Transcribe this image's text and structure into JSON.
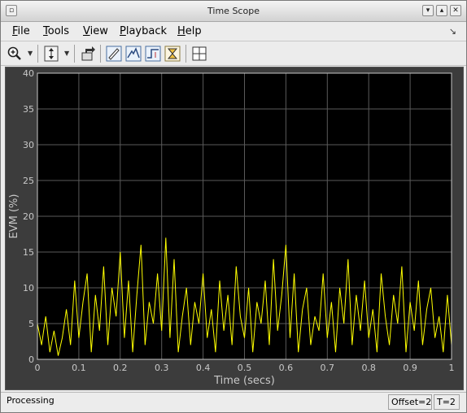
{
  "window": {
    "title": "Time Scope"
  },
  "menu": [
    {
      "label": "File",
      "ul": "F",
      "rest": "ile"
    },
    {
      "label": "Tools",
      "ul": "T",
      "rest": "ools"
    },
    {
      "label": "View",
      "ul": "V",
      "rest": "iew"
    },
    {
      "label": "Playback",
      "ul": "P",
      "rest": "layback"
    },
    {
      "label": "Help",
      "ul": "H",
      "rest": "elp"
    }
  ],
  "toolbar": {
    "icons": [
      "zoom-in-icon",
      "scale-axes-icon",
      "restore-view-icon",
      "measurement-icon",
      "peak-finder-icon",
      "bilevel-measurements-icon",
      "trigger-icon",
      "layout-icon"
    ]
  },
  "status": {
    "text": "Processing",
    "offset": "Offset=2",
    "time": "T=2"
  },
  "chart_data": {
    "type": "line",
    "xlabel": "Time (secs)",
    "ylabel": "EVM (%)",
    "xlim": [
      0,
      1
    ],
    "ylim": [
      0,
      40
    ],
    "xticks": [
      "0",
      "0.1",
      "0.2",
      "0.3",
      "0.4",
      "0.5",
      "0.6",
      "0.7",
      "0.8",
      "0.9",
      "1"
    ],
    "yticks": [
      "0",
      "5",
      "10",
      "15",
      "20",
      "25",
      "30",
      "35",
      "40"
    ],
    "grid": true,
    "colors": {
      "background": "#000000",
      "line": "#ffff00",
      "grid": "#5a5a5a",
      "axes": "#c8c8c8",
      "frame": "#3c3c3c"
    },
    "series": [
      {
        "x": [
          0.0,
          0.01,
          0.02,
          0.03,
          0.04,
          0.05,
          0.06,
          0.07,
          0.08,
          0.09,
          0.1,
          0.11,
          0.12,
          0.13,
          0.14,
          0.15,
          0.16,
          0.17,
          0.18,
          0.19,
          0.2,
          0.21,
          0.22,
          0.23,
          0.24,
          0.25,
          0.26,
          0.27,
          0.28,
          0.29,
          0.3,
          0.31,
          0.32,
          0.33,
          0.34,
          0.35,
          0.36,
          0.37,
          0.38,
          0.39,
          0.4,
          0.41,
          0.42,
          0.43,
          0.44,
          0.45,
          0.46,
          0.47,
          0.48,
          0.49,
          0.5,
          0.51,
          0.52,
          0.53,
          0.54,
          0.55,
          0.56,
          0.57,
          0.58,
          0.59,
          0.6,
          0.61,
          0.62,
          0.63,
          0.64,
          0.65,
          0.66,
          0.67,
          0.68,
          0.69,
          0.7,
          0.71,
          0.72,
          0.73,
          0.74,
          0.75,
          0.76,
          0.77,
          0.78,
          0.79,
          0.8,
          0.81,
          0.82,
          0.83,
          0.84,
          0.85,
          0.86,
          0.87,
          0.88,
          0.89,
          0.9,
          0.91,
          0.92,
          0.93,
          0.94,
          0.95,
          0.96,
          0.97,
          0.98,
          0.99,
          1.0
        ],
        "y": [
          5,
          2,
          6,
          1,
          4,
          0.5,
          3,
          7,
          2,
          11,
          3,
          8,
          12,
          1,
          9,
          4,
          13,
          2,
          10,
          6,
          15,
          3,
          11,
          1,
          9,
          16,
          2,
          8,
          5,
          12,
          4,
          17,
          3,
          14,
          1,
          6,
          10,
          2,
          8,
          5,
          12,
          3,
          7,
          1,
          11,
          4,
          9,
          2,
          13,
          6,
          3,
          10,
          1,
          8,
          5,
          11,
          2,
          14,
          4,
          9,
          16,
          3,
          12,
          1,
          7,
          10,
          2,
          6,
          4,
          12,
          3,
          8,
          1,
          10,
          5,
          14,
          2,
          9,
          4,
          11,
          3,
          7,
          1,
          12,
          6,
          2,
          9,
          5,
          13,
          1,
          8,
          4,
          11,
          2,
          7,
          10,
          3,
          6,
          1,
          9,
          2
        ]
      }
    ]
  }
}
